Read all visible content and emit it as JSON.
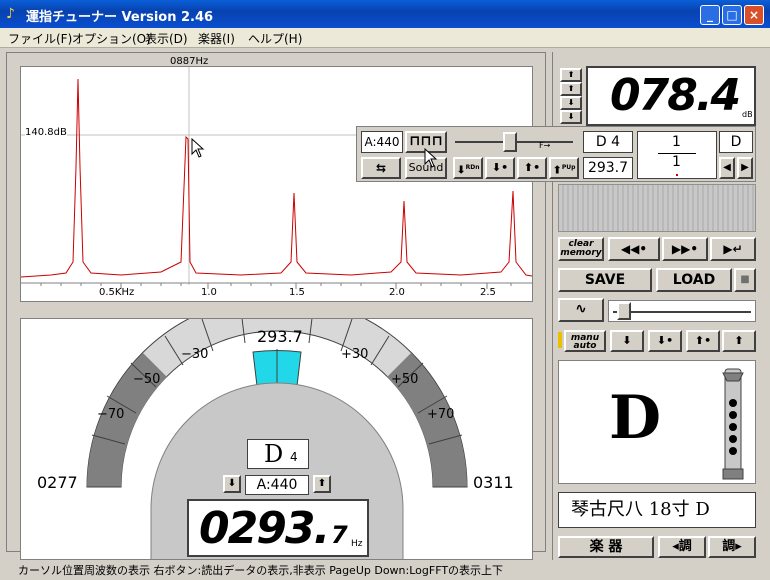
{
  "window": {
    "title": "運指チューナー  Version 2.46",
    "icon": "tuning-fork-icon"
  },
  "menu": [
    "ファイル(F)",
    "オプション(O)",
    "表示(D)",
    "楽器(I)",
    "ヘルプ(H)"
  ],
  "spectrum": {
    "cursor_freq": "0887Hz",
    "cursor_level": "140.8dB",
    "x_ticks": [
      "0.5KHz",
      "1.0",
      "1.5",
      "2.0",
      "2.5"
    ]
  },
  "tuner": {
    "target_freq": "293.7",
    "cents_labels": [
      "−70",
      "−50",
      "−30",
      "+30",
      "+50",
      "+70"
    ],
    "low_freq": "0277",
    "high_freq": "0311",
    "note": "D",
    "octave": "4",
    "pitch_ref": "A:440",
    "freq_big": "0293.",
    "freq_frac": "7",
    "freq_unit": "Hz"
  },
  "right": {
    "db_value": "078.4",
    "db_unit": "dB",
    "clear_memory": "clear memory",
    "save": "SAVE",
    "load": "LOAD",
    "manu_auto": "manu auto",
    "fingering_note": "D",
    "instrument_label": "琴古尺八  18寸 D",
    "instrument_btn": "楽 器",
    "tune_down": "◂調",
    "tune_up": "調▸"
  },
  "float_toolbar": {
    "pitch": "A:440",
    "sound": "Sound",
    "note": "D 4",
    "freq": "293.7",
    "fraction_top": "1",
    "fraction_bottom": "1",
    "slider_label": "F→",
    "rdn": "RDn",
    "pup": "PUp"
  },
  "statusbar": "カーソル位置周波数の表示  右ボタン:読出データの表示,非表示  PageUp Down:LogFFTの表示上下"
}
